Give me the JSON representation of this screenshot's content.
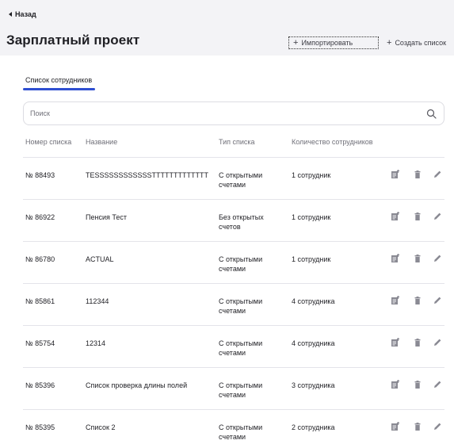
{
  "header": {
    "back_label": "Назад",
    "title": "Зарплатный проект",
    "import_label": "Импортировать",
    "create_label": "Создать список"
  },
  "tabs": [
    {
      "label": "Список сотрудников",
      "active": true
    }
  ],
  "search": {
    "placeholder": "Поиск",
    "value": ""
  },
  "table": {
    "columns": [
      "Номер списка",
      "Название",
      "Тип списка",
      "Количество сотрудников"
    ],
    "rows": [
      {
        "number": "№ 88493",
        "name": "TESSSSSSSSSSSSTTTTTTTTTTTTT",
        "type": "С открытыми счетами",
        "count": "1 сотрудник"
      },
      {
        "number": "№ 86922",
        "name": "Пенсия Тест",
        "type": "Без открытых счетов",
        "count": "1 сотрудник"
      },
      {
        "number": "№ 86780",
        "name": "ACTUAL",
        "type": "С открытыми счетами",
        "count": "1 сотрудник"
      },
      {
        "number": "№ 85861",
        "name": "112344",
        "type": "С открытыми счетами",
        "count": "4 сотрудника"
      },
      {
        "number": "№ 85754",
        "name": "12314",
        "type": "С открытыми счетами",
        "count": "4 сотрудника"
      },
      {
        "number": "№ 85396",
        "name": "Список проверка длины полей",
        "type": "С открытыми счетами",
        "count": "3 сотрудника"
      },
      {
        "number": "№ 85395",
        "name": "Список 2",
        "type": "С открытыми счетами",
        "count": "2 сотрудника"
      }
    ]
  },
  "icons": {
    "back": "caret-left-icon",
    "import": "plus-icon",
    "create": "plus-icon",
    "search": "search-icon",
    "row_actions": [
      "export-document-icon",
      "trash-icon",
      "pencil-icon"
    ]
  },
  "colors": {
    "accent": "#2f4fd1",
    "header_bg": "#f3f3f6",
    "icon_gray": "#8a8a93",
    "muted_text": "#6f6f78"
  }
}
